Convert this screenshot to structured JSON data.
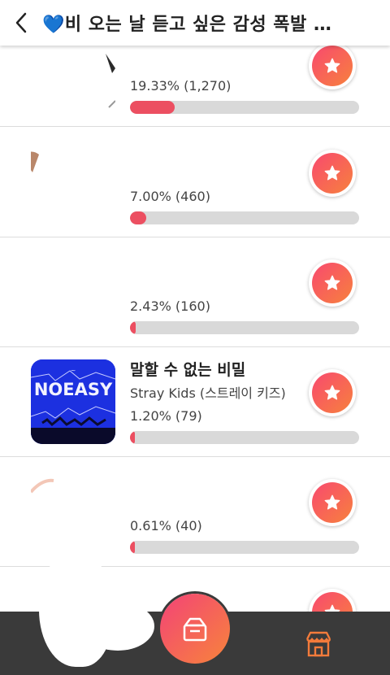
{
  "header": {
    "title": "💙비 오는 날 듣고 싶은 감성 폭발 노..."
  },
  "rows": [
    {
      "title": "",
      "artist": "",
      "percent_text": "19.33% (1,270)",
      "fraction": 0.1933
    },
    {
      "title": "",
      "artist": "",
      "percent_text": "7.00% (460)",
      "fraction": 0.07
    },
    {
      "title": "",
      "artist": "",
      "percent_text": "2.43% (160)",
      "fraction": 0.0243
    },
    {
      "title": "말할 수 없는 비밀",
      "artist": "Stray Kids (스트레이 키즈)",
      "percent_text": "1.20% (79)",
      "fraction": 0.012,
      "album_art_text": "NOEASY"
    },
    {
      "title": "",
      "artist": "",
      "percent_text": "0.61% (40)",
      "fraction": 0.0061
    }
  ],
  "colors": {
    "bar_fill": "#ec4f61",
    "bar_track": "#d9d9d9",
    "vote_gradient_start": "#f8496f",
    "vote_gradient_end": "#f7813d",
    "bottom_bar": "#3a3a3a",
    "store_icon": "#f37b3b"
  },
  "icons": {
    "back": "chevron-left-icon",
    "vote": "star-icon",
    "center": "ballot-box-icon",
    "store": "store-icon"
  }
}
